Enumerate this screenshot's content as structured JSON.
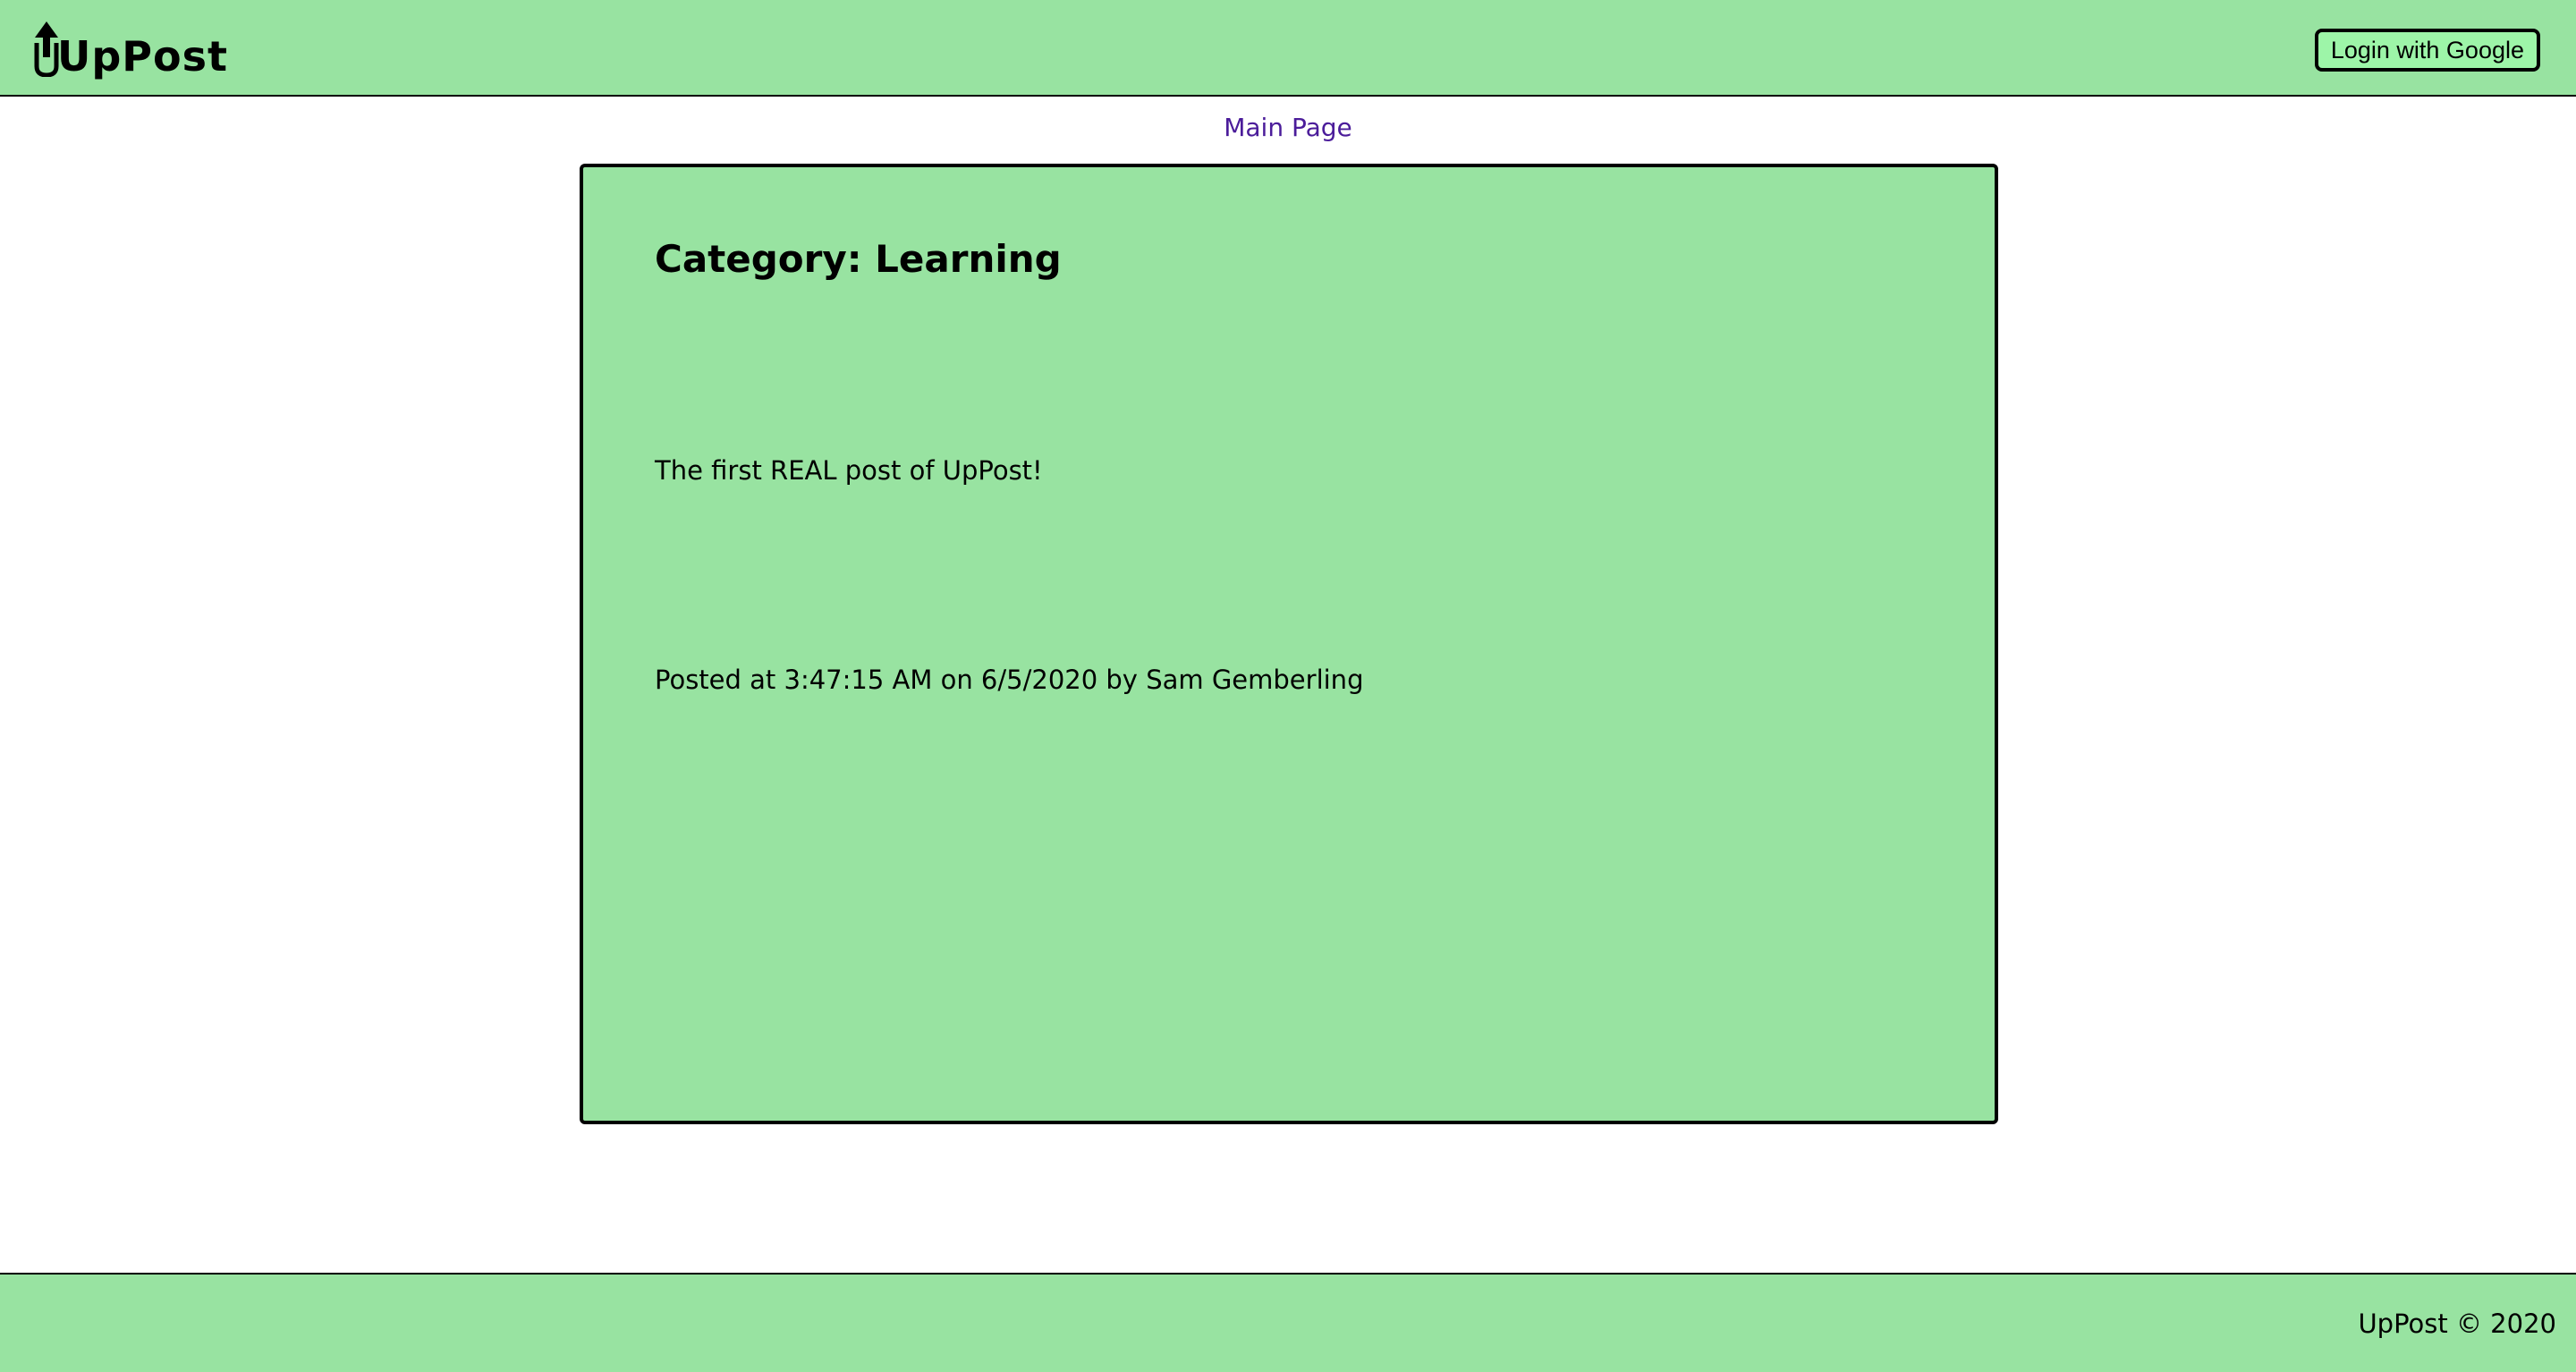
{
  "header": {
    "logo_text": "UpPost",
    "login_button": "Login with Google"
  },
  "nav": {
    "main_page_link": "Main Page"
  },
  "post": {
    "category_title": "Category: Learning",
    "body": "The first REAL post of UpPost!",
    "meta": "Posted at 3:47:15 AM on 6/5/2020 by Sam Gemberling"
  },
  "footer": {
    "text": "UpPost © 2020"
  },
  "colors": {
    "header_bg": "#98e3a1",
    "card_bg": "#98e3a1",
    "button_bg": "#9df5a8",
    "link": "#4b1c9a"
  },
  "icons": {
    "logo": "upload-arrow-icon"
  }
}
